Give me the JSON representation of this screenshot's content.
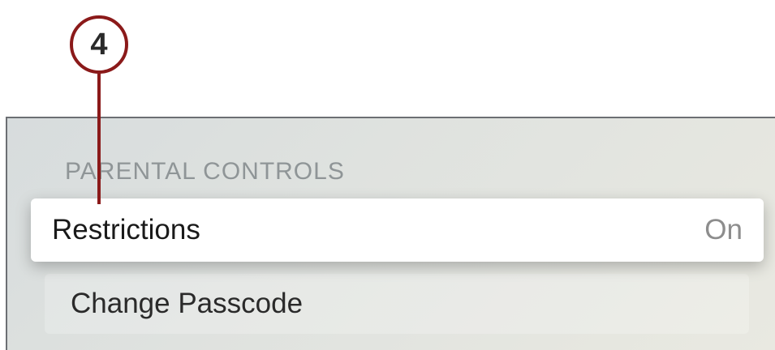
{
  "callout": {
    "number": "4",
    "color": "#8b1a1a"
  },
  "settings": {
    "section_header": "PARENTAL CONTROLS",
    "rows": [
      {
        "label": "Restrictions",
        "value": "On",
        "focused": true
      },
      {
        "label": "Change Passcode",
        "value": "",
        "focused": false
      }
    ]
  }
}
